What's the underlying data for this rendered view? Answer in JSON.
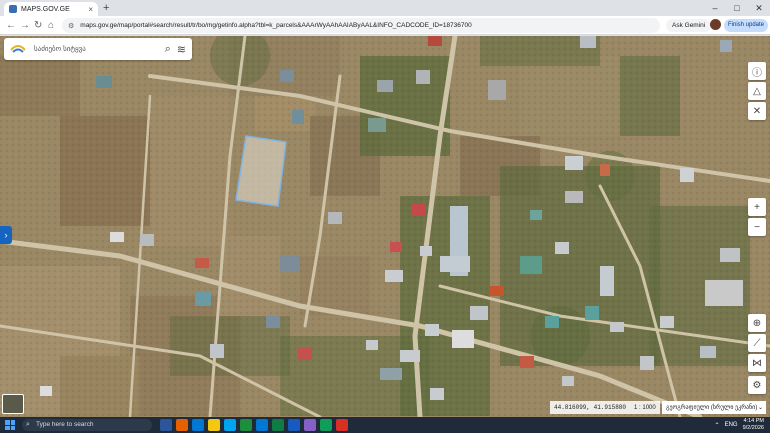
{
  "browser": {
    "tab_title": "MAPS.GOV.GE",
    "tab_close": "×",
    "new_tab": "+",
    "url": "maps.gov.ge/map/portal#search/result/tr/bo/mg/getinfo.alpha?tbl=k_parcels&AAArWyAAhAAIAByAAL&INFO_CADCODE_ID=18736700",
    "ask_gemini": "Ask Gemini",
    "finish_update": "Finish update",
    "nav_back": "←",
    "nav_forward": "→",
    "nav_reload": "↻",
    "nav_home": "⌂",
    "win_min": "–",
    "win_max": "□",
    "win_close": "✕"
  },
  "map": {
    "search_placeholder": "საძიებო სიტყვა",
    "search_icon": "⌕",
    "layers_icon": "≋",
    "expand_arrow": "›",
    "right_tools": [
      {
        "icon": "info-icon",
        "glyph": "ⓘ"
      },
      {
        "icon": "compass-icon",
        "glyph": "△"
      },
      {
        "icon": "tools-icon",
        "glyph": "✕"
      },
      {
        "icon": "zoom-in-icon",
        "glyph": "+"
      },
      {
        "icon": "zoom-out-icon",
        "glyph": "−"
      },
      {
        "icon": "locate-icon",
        "glyph": "⊕"
      },
      {
        "icon": "measure-icon",
        "glyph": "⟋"
      },
      {
        "icon": "share-icon",
        "glyph": "⋈"
      },
      {
        "icon": "settings-icon",
        "glyph": "⚙"
      }
    ],
    "coordinates": "44.816099, 41.915880",
    "scale": "1 : 1000",
    "basemap_select": "გეოგრაფიული (სრული ეკრანი)",
    "basemap_chevron": "⌄"
  },
  "taskbar": {
    "search_placeholder": "Type here to search",
    "search_icon": "⌕",
    "tray_temp": "⌃",
    "lang": "ENG",
    "time": "4:14 PM",
    "date": "9/2/2026",
    "app_colors": [
      "#2b579a",
      "#e66000",
      "#0078d4",
      "#f2c811",
      "#00a4ef",
      "#1e8e3e",
      "#0078d4",
      "#107c41",
      "#185abd",
      "#8661c5",
      "#0f9d58",
      "#d93025"
    ]
  },
  "colors": {
    "accent": "#1565c0",
    "parcel_outline": "#7fb3e6"
  }
}
